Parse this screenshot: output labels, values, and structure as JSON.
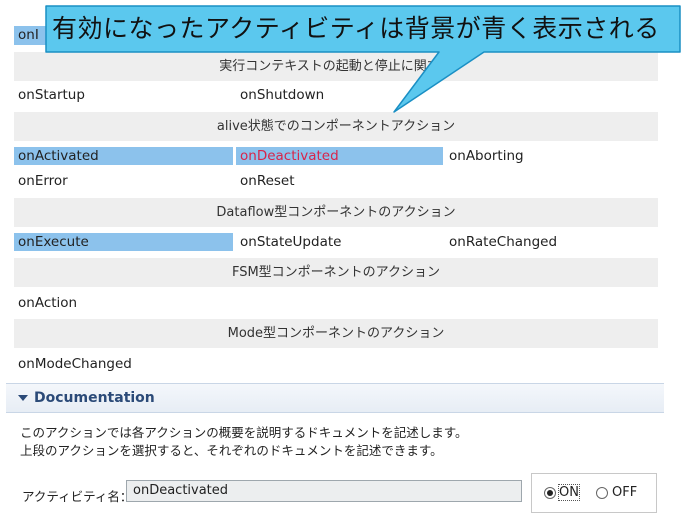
{
  "callout": {
    "text": "有効になったアクティビティは背景が青く表示される"
  },
  "top_cell": {
    "label": "onI"
  },
  "sections": {
    "context": "実行コンテキストの起動と停止に関する",
    "alive": "alive状態でのコンポーネントアクション",
    "dataflow": "Dataflow型コンポーネントのアクション",
    "fsm": "FSM型コンポーネントのアクション",
    "mode": "Mode型コンポーネントのアクション"
  },
  "actions": {
    "onStartup": "onStartup",
    "onShutdown": "onShutdown",
    "onActivated": "onActivated",
    "onDeactivated": "onDeactivated",
    "onAborting": "onAborting",
    "onError": "onError",
    "onReset": "onReset",
    "onExecute": "onExecute",
    "onStateUpdate": "onStateUpdate",
    "onRateChanged": "onRateChanged",
    "onAction": "onAction",
    "onModeChanged": "onModeChanged"
  },
  "documentation": {
    "title": "Documentation",
    "line1": "このアクションでは各アクションの概要を説明するドキュメントを記述します。",
    "line2": "上段のアクションを選択すると、それぞれのドキュメントを記述できます。",
    "activity_name_label": "アクティビティ名：",
    "activity_name_value": "onDeactivated",
    "radio_on": "ON",
    "radio_off": "OFF",
    "selected": "ON"
  },
  "colors": {
    "highlight": "#8cc2ec",
    "selected_text": "#d8254a",
    "callout_fill": "#5bc8ee",
    "callout_stroke": "#1a8fc4"
  }
}
